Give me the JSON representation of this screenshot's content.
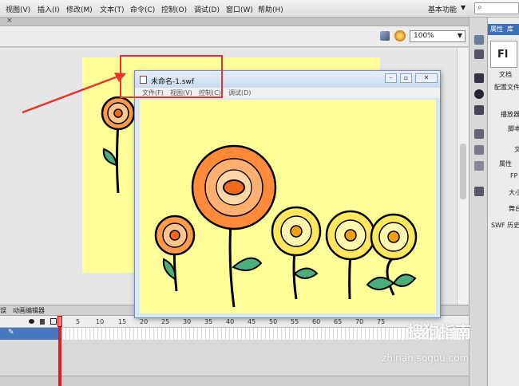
{
  "menu": {
    "items": [
      "视图(V)",
      "插入(I)",
      "修改(M)",
      "文本(T)",
      "命令(C)",
      "控制(O)",
      "调试(D)",
      "窗口(W)",
      "帮助(H)"
    ],
    "workspace": "基本功能"
  },
  "editbar": {
    "zoom": "100%"
  },
  "swf_window": {
    "title": "未命名-1.swf",
    "menu": [
      "文件(F)",
      "视图(V)",
      "控制(C)",
      "调试(D)"
    ]
  },
  "properties": {
    "tabs": [
      "属性",
      "库"
    ],
    "badge": "Fl",
    "lines": [
      "文档",
      "配置文件",
      "播放器",
      "脚本",
      "文",
      "属性",
      "FP",
      "大小",
      "舞台",
      "SWF 历史"
    ]
  },
  "timeline": {
    "tabs": [
      "误",
      "动画编辑器"
    ],
    "frame_numbers": [
      "5",
      "10",
      "15",
      "20",
      "25",
      "30",
      "35",
      "40",
      "45",
      "50",
      "55",
      "60",
      "65",
      "70",
      "75"
    ]
  },
  "watermark": {
    "title": "搜狗指南",
    "url": "zhinan.sogou.com"
  },
  "colors": {
    "stage": "#ffff99",
    "highlight": "#e8342e",
    "layer_selected": "#4a78c0"
  },
  "icons": [
    "search-icon",
    "close-icon",
    "eye-icon",
    "lock-icon",
    "pencil-icon",
    "flower-illustration"
  ]
}
